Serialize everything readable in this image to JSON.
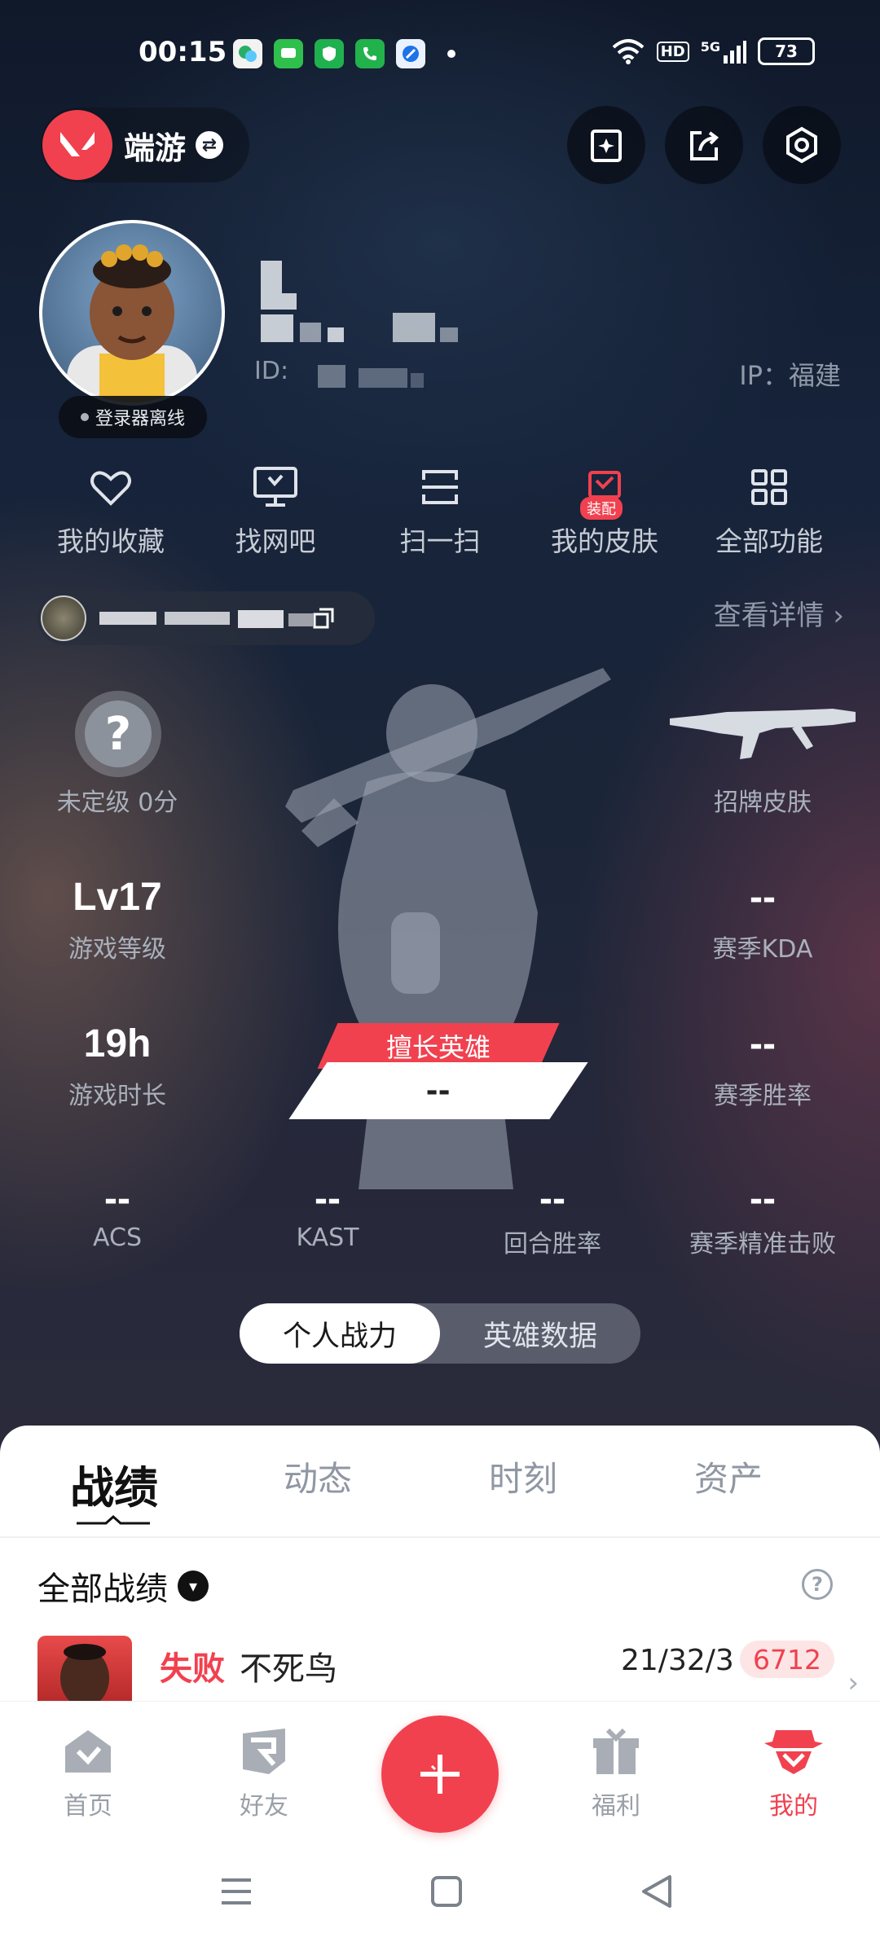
{
  "status_bar": {
    "time": "00:15",
    "network": "5G",
    "hd": "HD",
    "battery": "73",
    "app_icons": [
      "wechat-icon",
      "messages-icon",
      "security-icon",
      "phone-icon",
      "browser-icon"
    ]
  },
  "top_bar": {
    "game_switch_label": "端游",
    "buttons": [
      "card-icon",
      "share-icon",
      "settings-icon"
    ]
  },
  "profile": {
    "login_status": "登录器离线",
    "id_label": "ID:",
    "ip_label": "IP：福建"
  },
  "quick_actions": [
    {
      "label": "我的收藏",
      "icon": "heart-icon"
    },
    {
      "label": "找网吧",
      "icon": "monitor-icon"
    },
    {
      "label": "扫一扫",
      "icon": "scan-icon"
    },
    {
      "label": "我的皮肤",
      "icon": "skin-icon",
      "badge": "装配"
    },
    {
      "label": "全部功能",
      "icon": "grid-icon"
    }
  ],
  "player_card": {
    "view_detail": "查看详情 ›"
  },
  "stats": {
    "rank": {
      "label": "未定级 0分"
    },
    "signature_skin": {
      "label": "招牌皮肤"
    },
    "level": {
      "value": "Lv17",
      "label": "游戏等级"
    },
    "season_kda": {
      "value": "--",
      "label": "赛季KDA"
    },
    "play_time": {
      "value": "19h",
      "label": "游戏时长"
    },
    "season_winrate": {
      "value": "--",
      "label": "赛季胜率"
    },
    "favorite_hero": {
      "tag": "擅长英雄",
      "value": "--"
    },
    "acs": {
      "value": "--",
      "label": "ACS"
    },
    "kast": {
      "value": "--",
      "label": "KAST"
    },
    "round_winrate": {
      "value": "--",
      "label": "回合胜率"
    },
    "season_precise_kills": {
      "value": "--",
      "label": "赛季精准击败"
    }
  },
  "segment": {
    "active": "个人战力",
    "inactive": "英雄数据"
  },
  "tabs": [
    "战绩",
    "动态",
    "时刻",
    "资产"
  ],
  "records": {
    "filter_label": "全部战绩",
    "match": {
      "result": "失败",
      "hero": "不死鸟",
      "kda": "21/32/3",
      "score": "6712"
    }
  },
  "bottom_nav": [
    {
      "label": "首页",
      "icon": "home-icon"
    },
    {
      "label": "好友",
      "icon": "friends-icon"
    },
    {
      "label": "福利",
      "icon": "gift-icon"
    },
    {
      "label": "我的",
      "icon": "profile-icon",
      "active": true
    }
  ],
  "colors": {
    "accent": "#f1414f",
    "background": "#16233a"
  }
}
